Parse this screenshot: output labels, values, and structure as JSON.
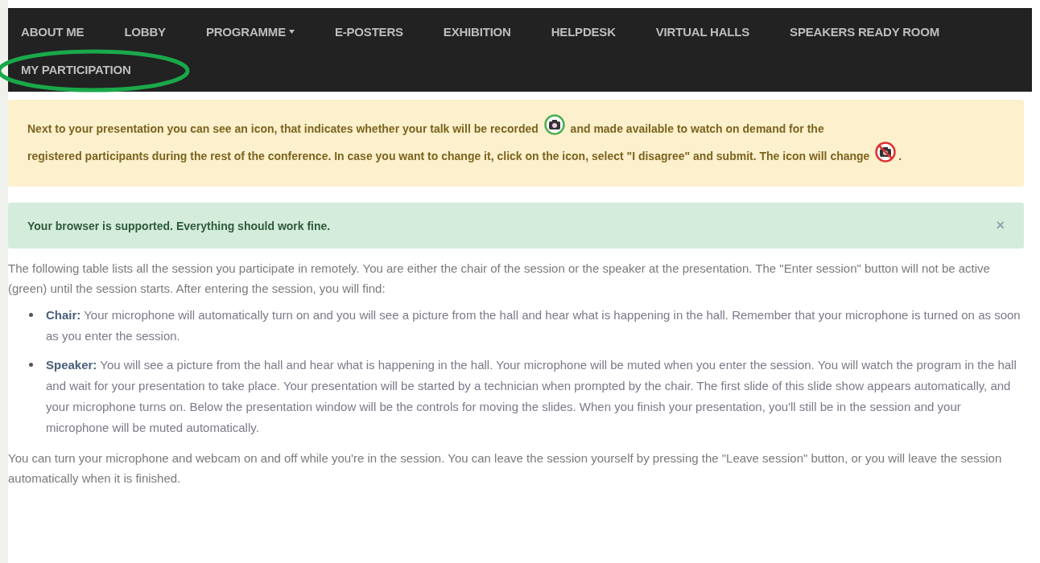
{
  "nav": {
    "items": [
      {
        "label": "ABOUT ME",
        "dropdown": false,
        "highlighted": false
      },
      {
        "label": "LOBBY",
        "dropdown": false,
        "highlighted": false
      },
      {
        "label": "PROGRAMME",
        "dropdown": true,
        "highlighted": false
      },
      {
        "label": "E-POSTERS",
        "dropdown": false,
        "highlighted": false
      },
      {
        "label": "EXHIBITION",
        "dropdown": false,
        "highlighted": false
      },
      {
        "label": "HELPDESK",
        "dropdown": false,
        "highlighted": false
      },
      {
        "label": "VIRTUAL HALLS",
        "dropdown": false,
        "highlighted": false
      },
      {
        "label": "SPEAKERS READY ROOM",
        "dropdown": false,
        "highlighted": false
      },
      {
        "label": "MY PARTICIPATION",
        "dropdown": false,
        "highlighted": true
      }
    ]
  },
  "warning_alert": {
    "segments": [
      {
        "kind": "text",
        "text": "Next to your presentation you can see an icon, that indicates whether your talk will be recorded"
      },
      {
        "kind": "camera_on"
      },
      {
        "kind": "text",
        "text": "and made available to watch on demand for the"
      },
      {
        "kind": "text",
        "text": "registered participants during the rest of the conference. In case you want to change it, click on the icon, select \"I disagree\" and submit. The icon will"
      },
      {
        "kind": "text",
        "text": "change"
      },
      {
        "kind": "camera_off"
      },
      {
        "kind": "text",
        "text": "."
      }
    ]
  },
  "success_alert": {
    "message": "Your browser is supported. Everything should work fine.",
    "close": "×"
  },
  "intro": "The following table lists all the session you participate in remotely. You are either the chair of the session or the speaker at the presentation. The \"Enter session\" button will not be active (green) until the session starts. After entering the session, you will find:",
  "roles": [
    "**Chair:** Your microphone will automatically turn on and you will see a picture from the hall and hear what is happening in the hall. Remember that your microphone is turned on as soon as you enter the session.",
    "**Speaker:** You will see a picture from the hall and hear what is happening in the hall. Your microphone will be muted when you enter the session. You will watch the program in the hall and wait for your presentation to take place. Your presentation will be started by a technician when prompted by the chair. The first slide of this slide show appears automatically, and your microphone turns on. Below the presentation window will be the controls for moving the slides. When you finish your presentation, you'll still be in the session and your microphone will be muted automatically."
  ],
  "outro": "You can turn your microphone and webcam on and off while you're in the session. You can leave the session yourself by pressing the \"Leave session\" button, or you will leave the session automatically when it is finished."
}
